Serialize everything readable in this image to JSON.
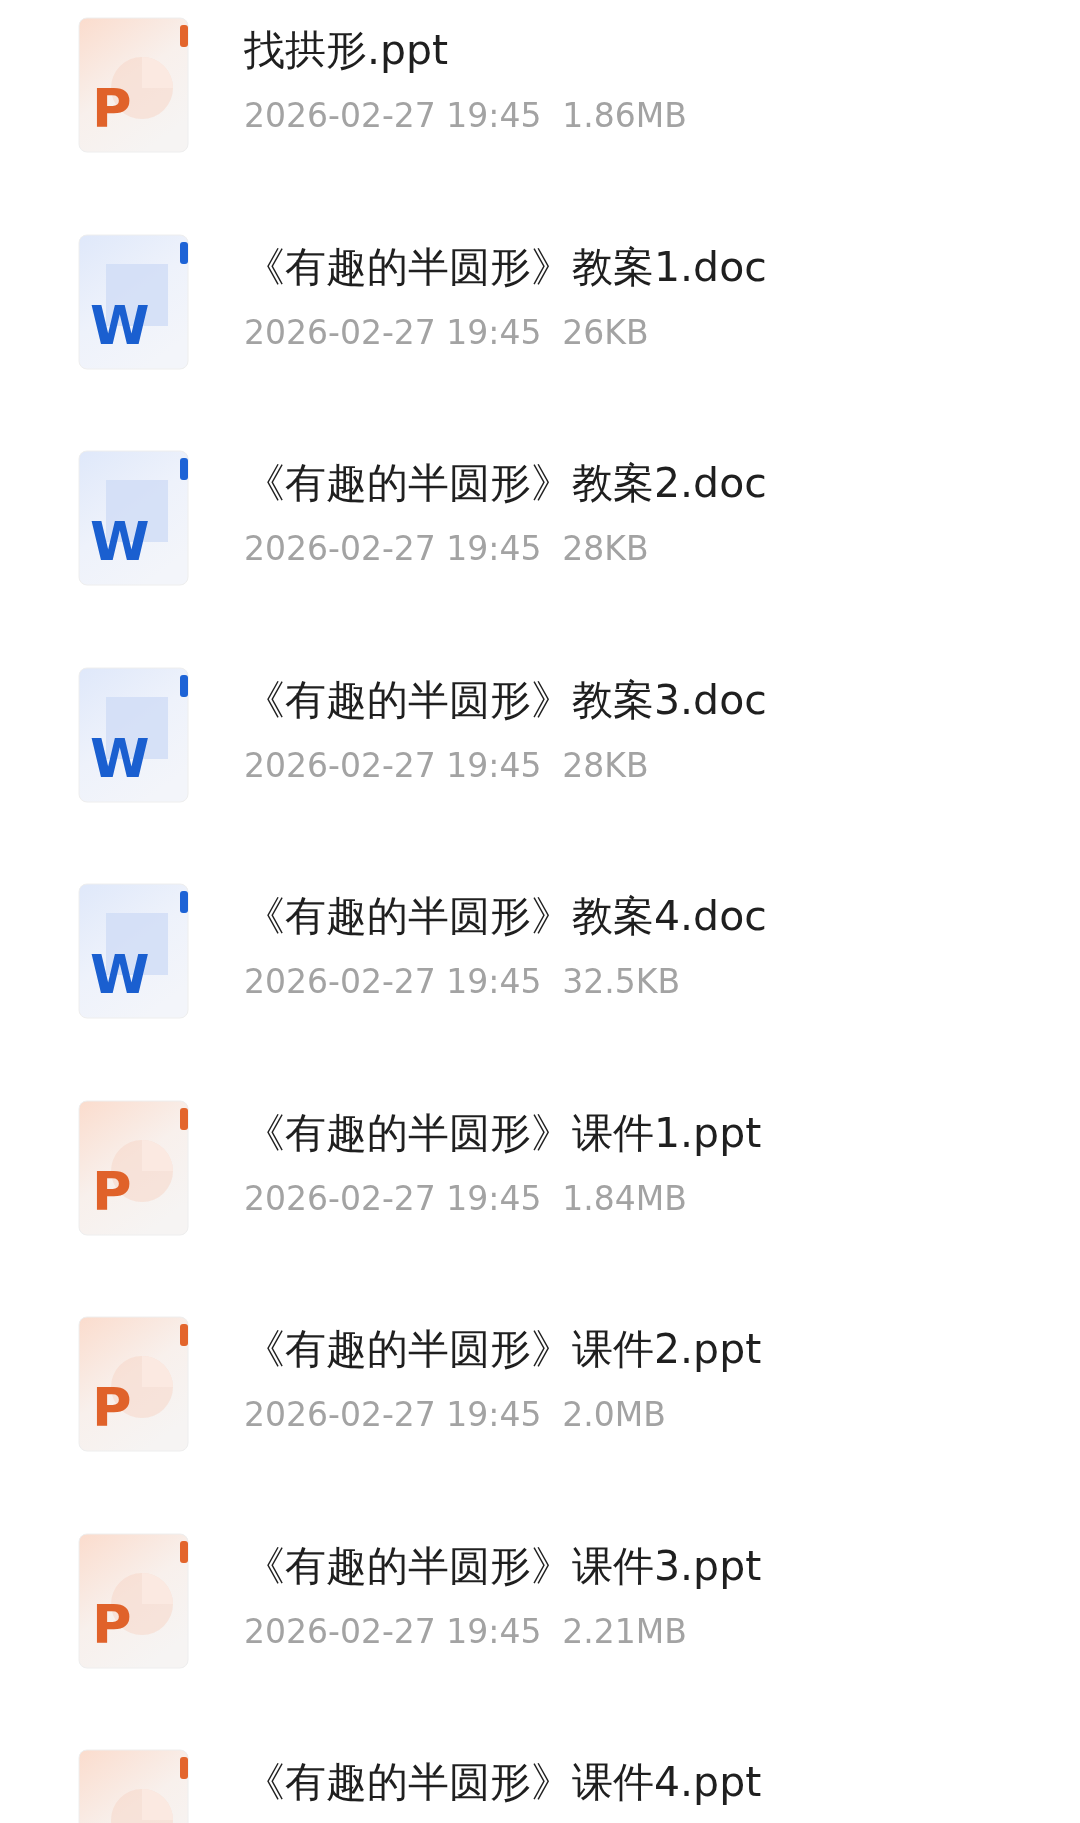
{
  "files": [
    {
      "kind": "ppt",
      "icon_letter": "P",
      "name": "找拱形.ppt",
      "meta": "2026-02-27 19:45  1.86MB"
    },
    {
      "kind": "doc",
      "icon_letter": "W",
      "name": "《有趣的半圆形》教案1.doc",
      "meta": "2026-02-27 19:45  26KB"
    },
    {
      "kind": "doc",
      "icon_letter": "W",
      "name": "《有趣的半圆形》教案2.doc",
      "meta": "2026-02-27 19:45  28KB"
    },
    {
      "kind": "doc",
      "icon_letter": "W",
      "name": "《有趣的半圆形》教案3.doc",
      "meta": "2026-02-27 19:45  28KB"
    },
    {
      "kind": "doc",
      "icon_letter": "W",
      "name": "《有趣的半圆形》教案4.doc",
      "meta": "2026-02-27 19:45  32.5KB"
    },
    {
      "kind": "ppt",
      "icon_letter": "P",
      "name": "《有趣的半圆形》课件1.ppt",
      "meta": "2026-02-27 19:45  1.84MB"
    },
    {
      "kind": "ppt",
      "icon_letter": "P",
      "name": "《有趣的半圆形》课件2.ppt",
      "meta": "2026-02-27 19:45  2.0MB"
    },
    {
      "kind": "ppt",
      "icon_letter": "P",
      "name": "《有趣的半圆形》课件3.ppt",
      "meta": "2026-02-27 19:45  2.21MB"
    },
    {
      "kind": "ppt",
      "name": "《有趣的半圆形》课件4.ppt"
    }
  ]
}
